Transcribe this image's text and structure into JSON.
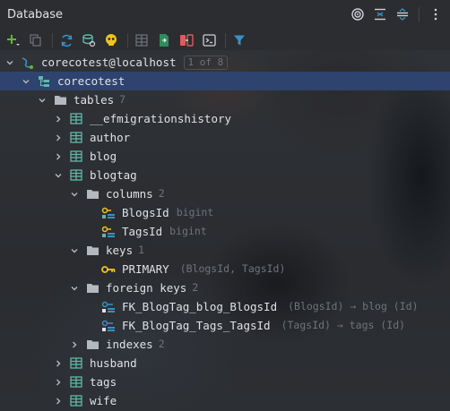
{
  "header": {
    "title": "Database"
  },
  "header_actions": [
    "target-icon",
    "collapse-all-icon",
    "expand-all-icon",
    "more-vertical-icon"
  ],
  "toolbar": [
    "add-icon",
    "duplicate-icon",
    "refresh-icon",
    "schema-icon",
    "console-icon",
    "table-view-icon",
    "jump-to-editor-icon",
    "compare-icon",
    "terminal-icon",
    "filter-icon"
  ],
  "tree": {
    "connection": {
      "label": "corecotest@localhost",
      "badge": "1 of 8"
    },
    "database": {
      "label": "corecotest"
    },
    "tables_folder": {
      "label": "tables",
      "count": "7"
    },
    "table_efmigrationshistory": {
      "label": "__efmigrationshistory"
    },
    "table_author": {
      "label": "author"
    },
    "table_blog": {
      "label": "blog"
    },
    "table_blogtag": {
      "label": "blogtag"
    },
    "columns_folder": {
      "label": "columns",
      "count": "2"
    },
    "column_blogsid": {
      "label": "BlogsId",
      "type": "bigint"
    },
    "column_tagsid": {
      "label": "TagsId",
      "type": "bigint"
    },
    "keys_folder": {
      "label": "keys",
      "count": "1"
    },
    "key_primary": {
      "label": "PRIMARY",
      "detail": "(BlogsId, TagsId)"
    },
    "fk_folder": {
      "label": "foreign keys",
      "count": "2"
    },
    "fk_blog": {
      "label": "FK_BlogTag_blog_BlogsId",
      "detail": "(BlogsId) → blog (Id)"
    },
    "fk_tags": {
      "label": "FK_BlogTag_Tags_TagsId",
      "detail": "(TagsId) → tags (Id)"
    },
    "indexes_folder": {
      "label": "indexes",
      "count": "2"
    },
    "table_husband": {
      "label": "husband"
    },
    "table_tags": {
      "label": "tags"
    },
    "table_wife": {
      "label": "wife"
    }
  },
  "colors": {
    "selection": "#2e436e",
    "accent": "#3592c4",
    "key_gold": "#f0c419",
    "table_icon": "#5fb8a8"
  }
}
